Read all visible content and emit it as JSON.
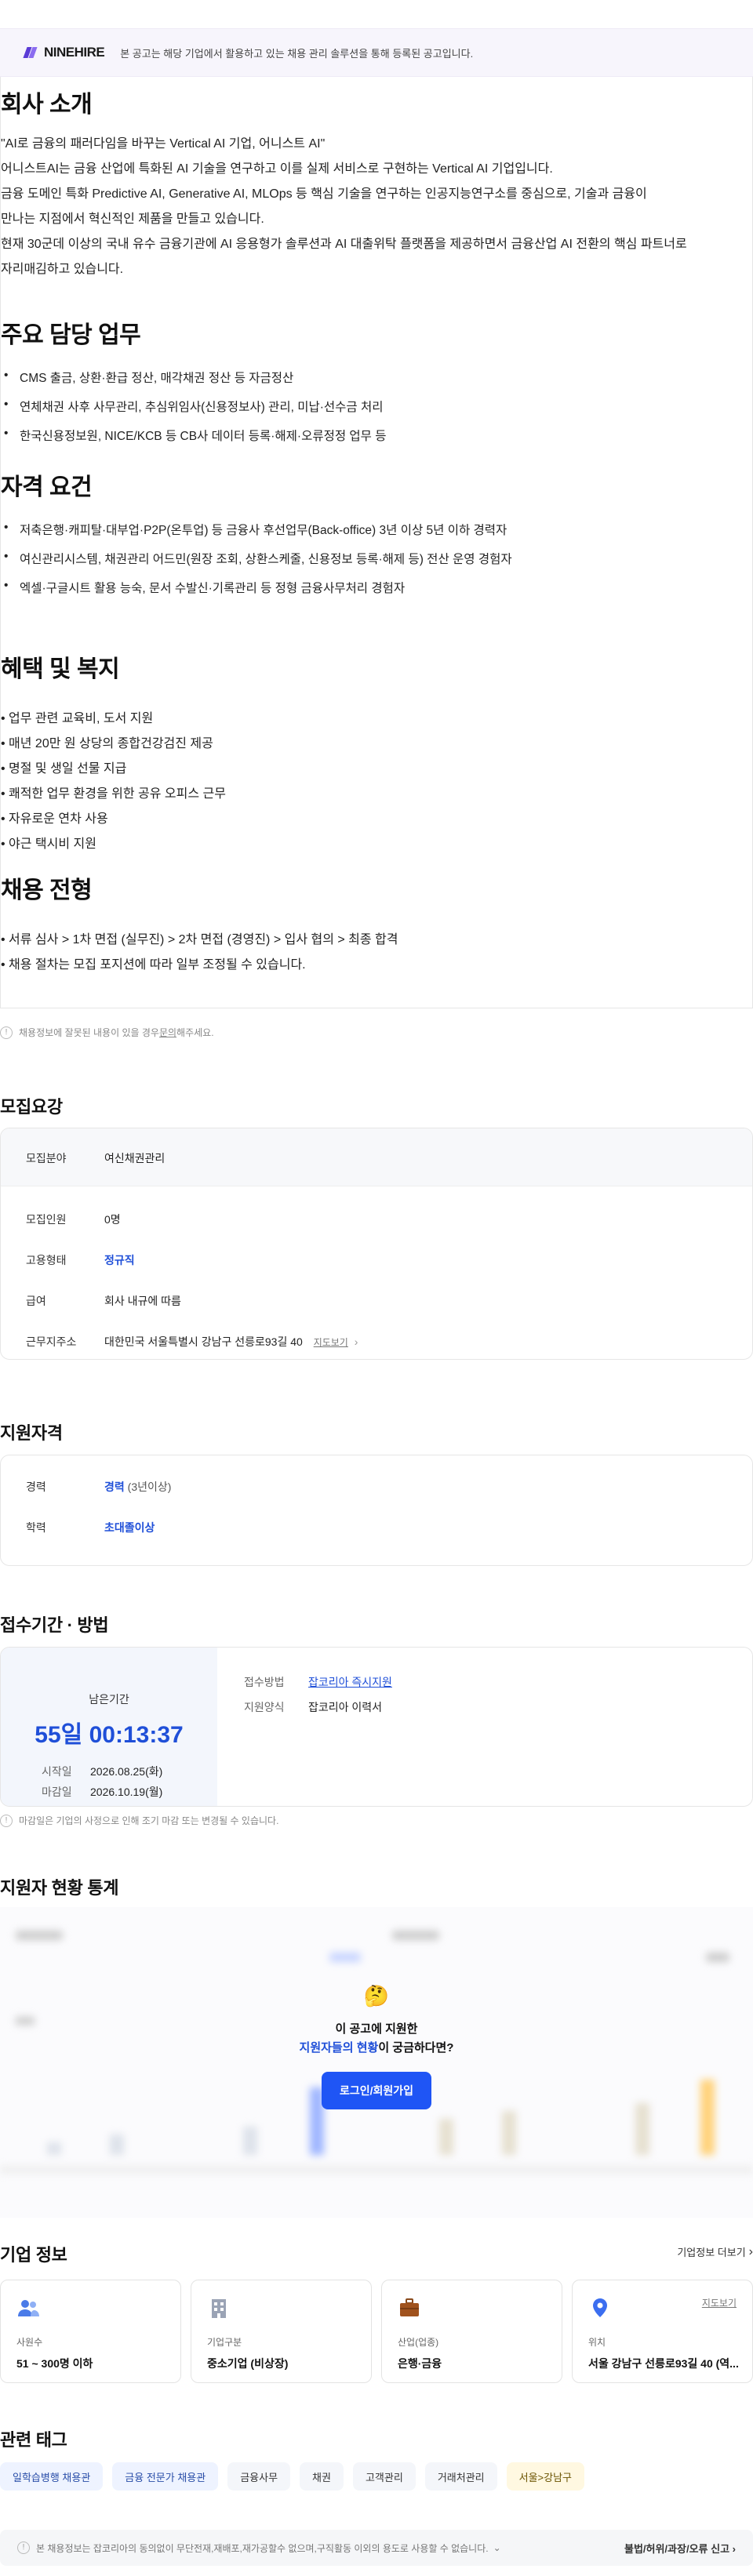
{
  "banner": {
    "logo": "NINEHIRE",
    "text": "본 공고는 해당 기업에서 활용하고 있는 채용 관리 솔루션을 통해 등록된 공고입니다."
  },
  "intro": {
    "title": "회사 소개",
    "lines": [
      "\"AI로 금융의 패러다임을 바꾸는 Vertical AI 기업, 어니스트 AI\"",
      "어니스트AI는 금융 산업에 특화된 AI 기술을 연구하고 이를 실제 서비스로 구현하는 Vertical AI 기업입니다.",
      "금융 도메인 특화 Predictive AI, Generative AI, MLOps 등 핵심 기술을 연구하는 인공지능연구소를 중심으로, 기술과 금융이",
      "만나는 지점에서 혁신적인 제품을 만들고 있습니다.",
      "현재 30군데 이상의 국내 유수 금융기관에 AI 응용형가 솔루션과 AI 대출위탁 플랫폼을 제공하면서 금융산업 AI 전환의 핵심 파트너로",
      "자리매김하고 있습니다."
    ]
  },
  "duties": {
    "title": "주요 담당 업무",
    "items": [
      "CMS 출금, 상환·환급 정산, 매각채권 정산 등 자금정산",
      "연체채권 사후 사무관리, 추심위임사(신용정보사) 관리, 미납·선수금 처리",
      "한국신용정보원, NICE/KCB 등 CB사 데이터 등록·해제·오류정정 업무 등"
    ]
  },
  "quals": {
    "title": "자격 요건",
    "items": [
      "저축은행·캐피탈·대부업·P2P(온투업) 등 금융사 후선업무(Back-office) 3년 이상 5년 이하 경력자",
      "여신관리시스템, 채권관리 어드민(원장 조회, 상환스케줄, 신용정보 등록·해제 등) 전산 운영 경험자",
      "엑셀·구글시트 활용 능숙, 문서 수발신·기록관리 등 정형 금융사무처리 경험자"
    ]
  },
  "benefits": {
    "title": "혜택 및 복지",
    "items": [
      "• 업무 관련 교육비, 도서 지원",
      "• 매년 20만 원 상당의 종합건강검진 제공",
      "• 명절 및 생일 선물 지급",
      "• 쾌적한 업무 환경을 위한 공유 오피스 근무",
      "• 자유로운 연차 사용",
      "• 야근 택시비 지원"
    ]
  },
  "process": {
    "title": "채용 전형",
    "items": [
      "• 서류 심사 >  1차 면접 (실무진) >  2차 면접 (경영진) >  입사 협의  >  최종 합격",
      "• 채용 절차는 모집 포지션에 따라 일부 조정될 수 있습니다."
    ]
  },
  "notice": {
    "text": "채용정보에 잘못된 내용이 있을 경우 ",
    "link": "문의",
    "suffix": "해주세요."
  },
  "recruit": {
    "title": "모집요강",
    "field_label": "모집분야",
    "field_value": "여신채권관리",
    "count_label": "모집인원",
    "count_value": "0명",
    "type_label": "고용형태",
    "type_value": "정규직",
    "pay_label": "급여",
    "pay_value": "회사 내규에 따름",
    "loc_label": "근무지주소",
    "loc_value": "대한민국 서울특별시 강남구 선릉로93길 40",
    "map_link": "지도보기"
  },
  "eligibility": {
    "title": "지원자격",
    "career_label": "경력",
    "career_value": "경력",
    "career_extra": "(3년이상)",
    "edu_label": "학력",
    "edu_value": "초대졸이상"
  },
  "period": {
    "title": "접수기간 · 방법",
    "remain_label": "남은기간",
    "remain_value": "55일 00:13:37",
    "start_label": "시작일",
    "start_value": "2026.08.25(화)",
    "end_label": "마감일",
    "end_value": "2026.10.19(월)",
    "method_label": "접수방법",
    "method_value": "잡코리아 즉시지원",
    "form_label": "지원양식",
    "form_value": "잡코리아 이력서",
    "note": "마감일은 기업의 사정으로 인해 조기 마감 또는 변경될 수 있습니다."
  },
  "stats": {
    "title": "지원자 현황 통계",
    "emoji": "🤔",
    "line1": "이 공고에 지원한",
    "line2_blue": "지원자들의 현황",
    "line2_rest": "이 궁금하다면?",
    "button": "로그인/회원가입"
  },
  "company": {
    "title": "기업 정보",
    "more": "기업정보 더보기",
    "cards": [
      {
        "icon": "people-icon",
        "label": "사원수",
        "value": "51 ~ 300명 이하"
      },
      {
        "icon": "building-icon",
        "label": "기업구분",
        "value": "중소기업 (비상장)"
      },
      {
        "icon": "briefcase-icon",
        "label": "산업(업종)",
        "value": "은행·금융"
      },
      {
        "icon": "location-icon",
        "label": "위치",
        "value": "서울 강남구 선릉로93길 40 (역...",
        "link": "지도보기"
      }
    ]
  },
  "tags": {
    "title": "관련 태그",
    "items": [
      "일학습병행 채용관",
      "금융 전문가 채용관",
      "금융사무",
      "채권",
      "고객관리",
      "거래처관리",
      "서울>강남구"
    ]
  },
  "footer": {
    "text": "본 채용정보는 잡코리아의 동의없이 무단전재,재배포,재가공할수 없으며,구직활동 이외의 용도로 사용할 수 없습니다.",
    "report": "불법/허위/과장/오류 신고"
  },
  "colors": {
    "accent": "#1f4fd8",
    "button": "#1f55f5",
    "brand": "#5b3bd6"
  }
}
